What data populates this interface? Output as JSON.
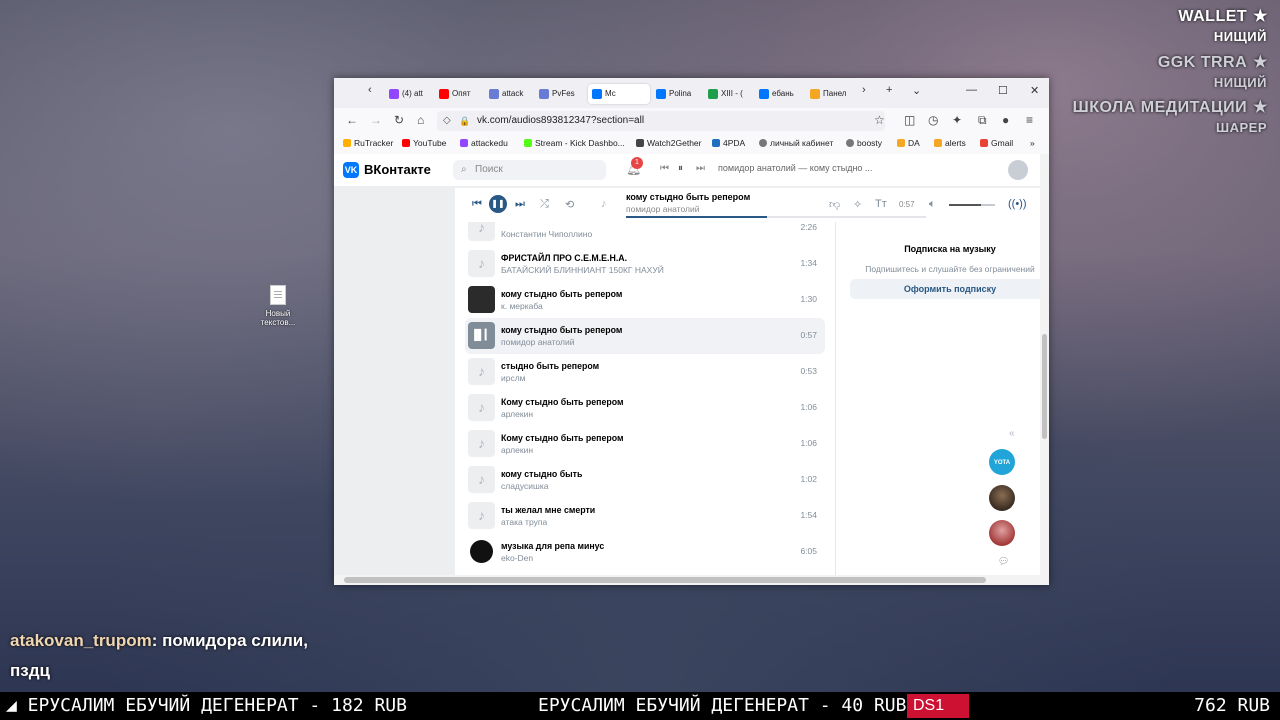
{
  "overlay": {
    "items": [
      {
        "label": "WALLET",
        "value": "НИЩИЙ"
      },
      {
        "label": "GGK TRRA",
        "value": "НИЩИЙ"
      },
      {
        "label": "ШКОЛА МЕДИТАЦИИ",
        "value": "ШАРЕР"
      }
    ]
  },
  "desktop_icon": {
    "line1": "Новый",
    "line2": "текстов..."
  },
  "chat": {
    "user": "atakovan_trupom",
    "message": "помидора слили, пздц"
  },
  "ticker": {
    "left": "◢ ЕРУСАЛИМ ЕБУЧИЙ ДЕГЕНЕРАТ - 182 RUB",
    "middle": "ЕРУСАЛИМ ЕБУЧИЙ ДЕГЕНЕРАТ - 40 RUB ▲",
    "tag": "DS1",
    "right": "762 RUB"
  },
  "browser": {
    "tabs": [
      "(4) att",
      "Опят",
      "attack",
      "PvFes",
      "Мс",
      "Polina",
      "XIII - (",
      "ебань",
      "Панел"
    ],
    "url": "vk.com/audios893812347?section=all",
    "bookmarks": [
      "RuTracker",
      "YouTube",
      "attackedu",
      "Stream - Kick Dashbo...",
      "Watch2Gether",
      "4PDA",
      "личный кабинет",
      "boosty",
      "DA",
      "alerts",
      "Gmail"
    ]
  },
  "vk": {
    "logo": "ВКонтакте",
    "search_placeholder": "Поиск",
    "notifications": "1",
    "mini_now_playing": "помидор анатолий — кому стыдно ...",
    "player": {
      "title": "кому стыдно быть репером",
      "artist": "помидор анатолий",
      "time": "0:57",
      "progress": 0.47
    },
    "tracks": [
      {
        "title": "",
        "artist": "Константин Чиполлино",
        "duration": "2:26"
      },
      {
        "title": "ФРИСТАЙЛ ПРО С.Е.М.Е.Н.А.",
        "artist": "БАТАЙСКИЙ БЛИННИАНТ 150КГ НАХУЙ",
        "duration": "1:34"
      },
      {
        "title": "кому стыдно быть репером",
        "artist": "к. меркаба",
        "duration": "1:30"
      },
      {
        "title": "кому стыдно быть репером",
        "artist": "помидор анатолий",
        "duration": "0:57"
      },
      {
        "title": "стыдно быть репером",
        "artist": "ирслм",
        "duration": "0:53"
      },
      {
        "title": "Кому стыдно быть репером",
        "artist": "арлекин",
        "duration": "1:06"
      },
      {
        "title": "Кому стыдно быть репером",
        "artist": "арлекин",
        "duration": "1:06"
      },
      {
        "title": "кому стыдно быть",
        "artist": "сладусишка",
        "duration": "1:02"
      },
      {
        "title": "ты желал мне смерти",
        "artist": "атака трупа",
        "duration": "1:54"
      },
      {
        "title": "музыка для репа минус",
        "artist": "eko-Den",
        "duration": "6:05"
      }
    ],
    "subscription": {
      "title": "Подписка на музыку",
      "desc": "Подпишитесь и слушайте без ограничений",
      "button": "Оформить подписку"
    },
    "yota": "YOTA"
  }
}
